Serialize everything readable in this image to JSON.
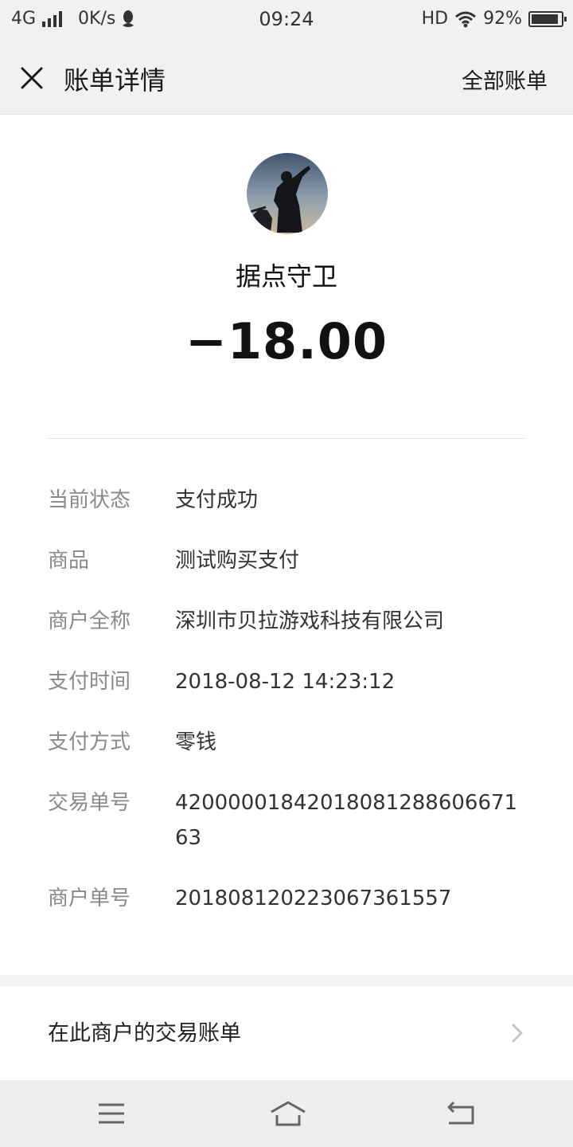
{
  "status_bar": {
    "network": "4G",
    "speed": "0K/s",
    "time": "09:24",
    "hd": "HD",
    "battery_text": "92%",
    "battery_level": 0.92
  },
  "nav": {
    "title": "账单详情",
    "right_link": "全部账单"
  },
  "merchant": {
    "name": "据点守卫",
    "amount": "−18.00"
  },
  "details": [
    {
      "label": "当前状态",
      "value": "支付成功"
    },
    {
      "label": "商品",
      "value": "测试购买支付"
    },
    {
      "label": "商户全称",
      "value": "深圳市贝拉游戏科技有限公司"
    },
    {
      "label": "支付时间",
      "value": "2018-08-12 14:23:12"
    },
    {
      "label": "支付方式",
      "value": "零钱"
    },
    {
      "label": "交易单号",
      "value": "420000018420180812886066716​3"
    },
    {
      "label": "商户单号",
      "value": "201808120223067361557"
    }
  ],
  "merchant_link": {
    "label": "在此商户的交易账单"
  },
  "colors": {
    "bar_bg": "#f1f1f1",
    "label_gray": "#8a8a8a",
    "text_dark": "#1a1a1a"
  }
}
